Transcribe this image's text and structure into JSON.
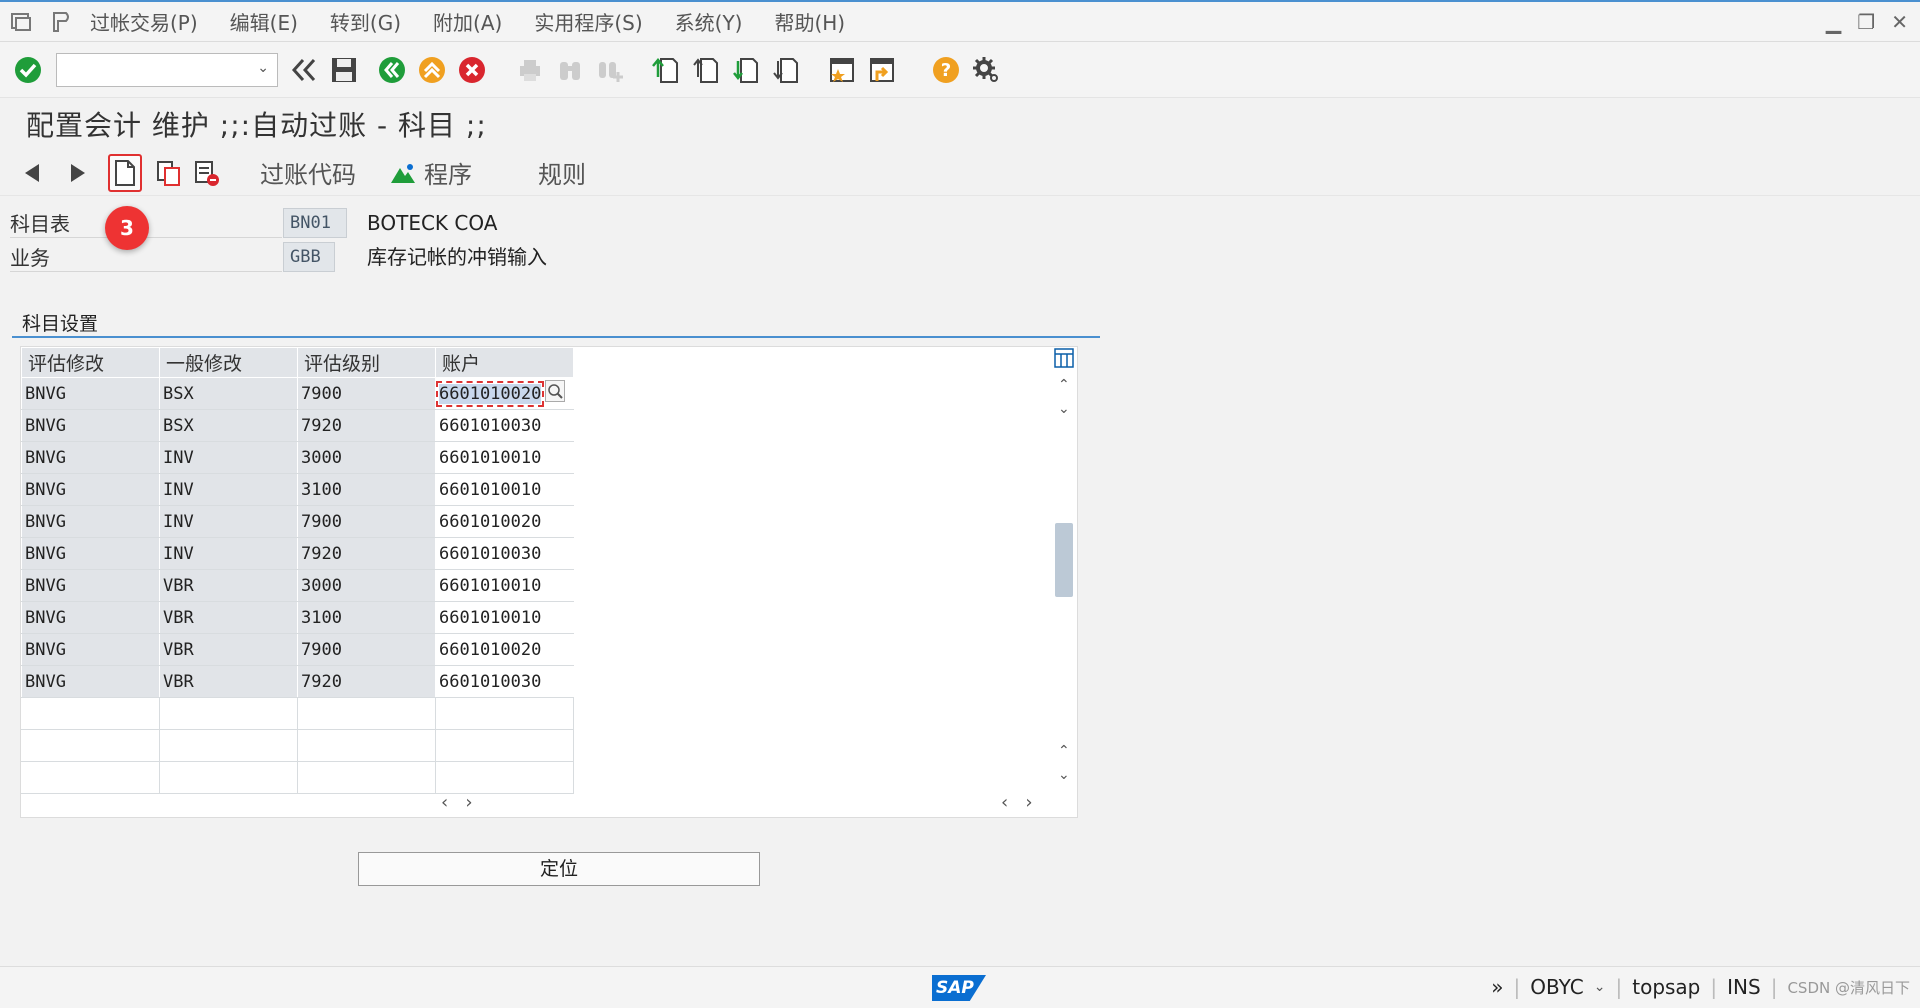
{
  "menu": {
    "items": [
      "过帐交易(P)",
      "编辑(E)",
      "转到(G)",
      "附加(A)",
      "实用程序(S)",
      "系统(Y)",
      "帮助(H)"
    ]
  },
  "toolbar": {
    "command_value": ""
  },
  "title": "配置会计 维护 ;;:自动过账 - 科目 ;;",
  "app_toolbar": {
    "posting_code": "过账代码",
    "program": "程序",
    "rules": "规则"
  },
  "callout": "3",
  "header": {
    "chart_label": "科目表",
    "chart_value": "BN01",
    "chart_desc": "BOTECK COA",
    "business_label": "业务",
    "business_value": "GBB",
    "business_desc": "库存记帐的冲销输入"
  },
  "panel": {
    "title": "科目设置",
    "columns": [
      "评估修改",
      "一般修改",
      "评估级别",
      "账户"
    ],
    "rows": [
      [
        "BNVG",
        "BSX",
        "7900",
        "6601010020"
      ],
      [
        "BNVG",
        "BSX",
        "7920",
        "6601010030"
      ],
      [
        "BNVG",
        "INV",
        "3000",
        "6601010010"
      ],
      [
        "BNVG",
        "INV",
        "3100",
        "6601010010"
      ],
      [
        "BNVG",
        "INV",
        "7900",
        "6601010020"
      ],
      [
        "BNVG",
        "INV",
        "7920",
        "6601010030"
      ],
      [
        "BNVG",
        "VBR",
        "3000",
        "6601010010"
      ],
      [
        "BNVG",
        "VBR",
        "3100",
        "6601010010"
      ],
      [
        "BNVG",
        "VBR",
        "7900",
        "6601010020"
      ],
      [
        "BNVG",
        "VBR",
        "7920",
        "6601010030"
      ]
    ],
    "locate": "定位"
  },
  "status": {
    "transaction": "OBYC",
    "system": "topsap",
    "mode": "INS",
    "watermark": "CSDN @清风日下"
  },
  "colors": {
    "accent": "#4a90d0",
    "badge": "#e33333",
    "ok": "#1f9d3a"
  }
}
